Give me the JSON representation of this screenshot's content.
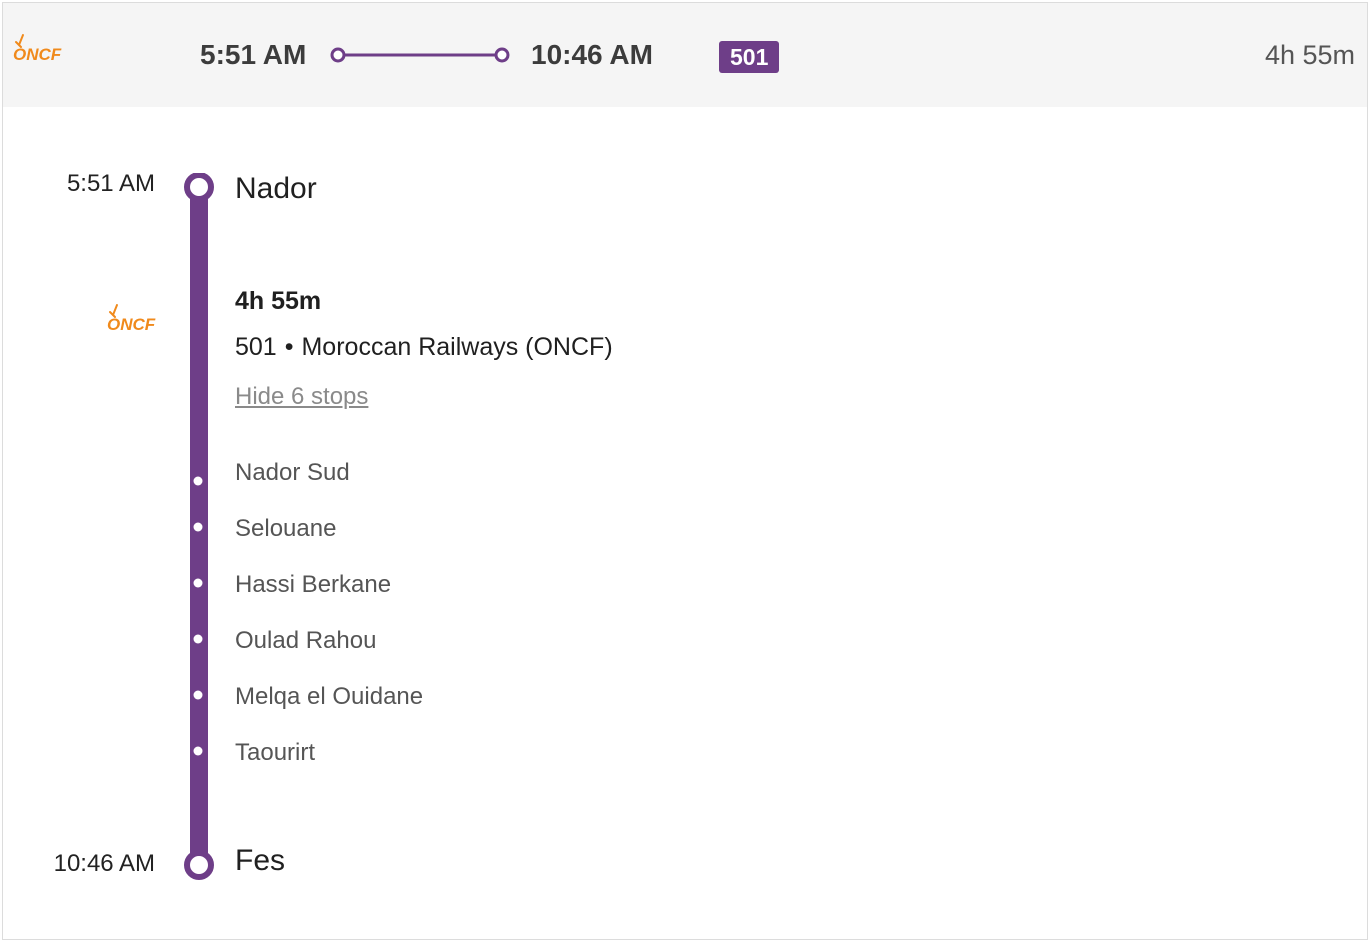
{
  "summary": {
    "operator_logo": {
      "icon": "oncf-logo-icon",
      "text": "ONCF",
      "color": "#f08a1c"
    },
    "departure_time": "5:51 AM",
    "arrival_time": "10:46 AM",
    "train_number": "501",
    "duration": "4h 55m"
  },
  "itinerary": {
    "departure": {
      "time": "5:51 AM",
      "station": "Nador"
    },
    "arrival": {
      "time": "10:46 AM",
      "station": "Fes"
    },
    "leg": {
      "operator_logo": {
        "icon": "oncf-logo-icon",
        "text": "ONCF"
      },
      "duration": "4h 55m",
      "train_number": "501",
      "separator": "•",
      "operator": "Moroccan Railways (ONCF)",
      "toggle_stops_label": "Hide 6 stops",
      "stops": [
        "Nador Sud",
        "Selouane",
        "Hassi Berkane",
        "Oulad Rahou",
        "Melqa el Ouidane",
        "Taourirt"
      ]
    }
  },
  "colors": {
    "route": "#6e3e88",
    "header_bg": "#f5f5f5",
    "logo": "#f08a1c"
  }
}
